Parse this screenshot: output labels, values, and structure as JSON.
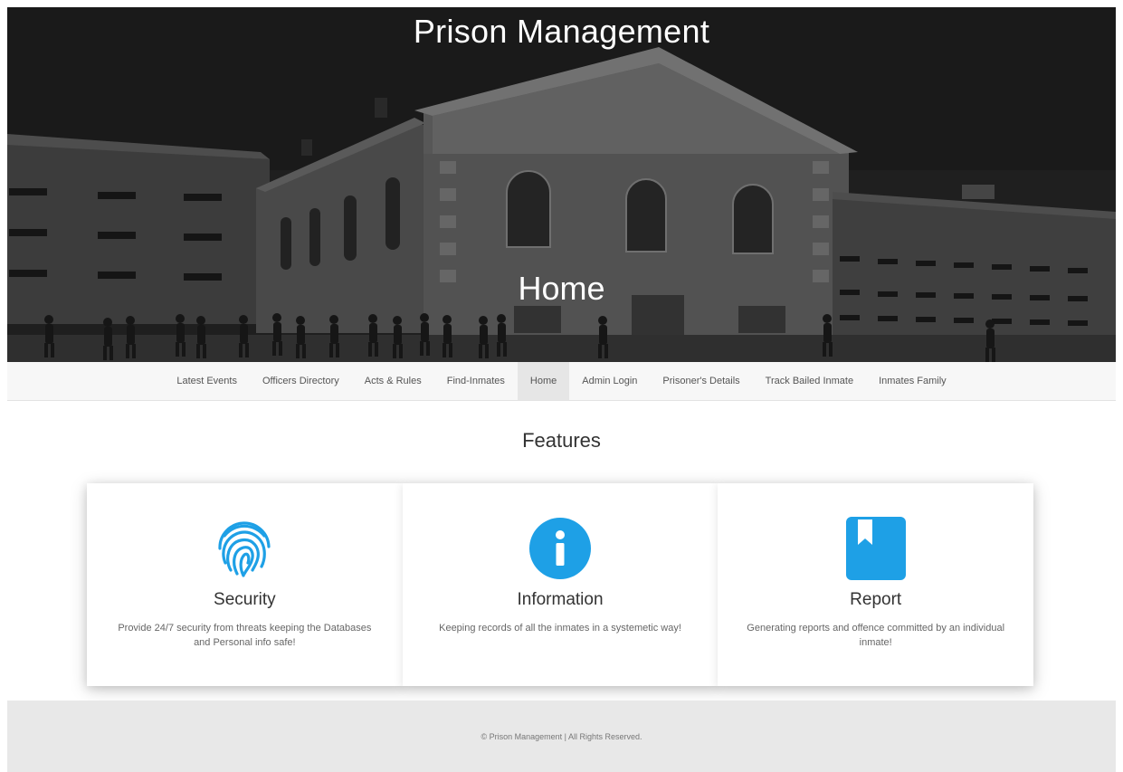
{
  "hero": {
    "title": "Prison Management",
    "subtitle": "Home"
  },
  "nav": {
    "items": [
      {
        "label": "Latest Events"
      },
      {
        "label": "Officers Directory"
      },
      {
        "label": "Acts & Rules"
      },
      {
        "label": "Find-Inmates"
      },
      {
        "label": "Home",
        "active": true
      },
      {
        "label": "Admin Login"
      },
      {
        "label": "Prisoner's Details"
      },
      {
        "label": "Track Bailed Inmate"
      },
      {
        "label": "Inmates Family"
      }
    ]
  },
  "features": {
    "title": "Features",
    "cards": [
      {
        "title": "Security",
        "desc": "Provide 24/7 security from threats keeping the Databases and Personal info safe!",
        "icon": "fingerprint-icon"
      },
      {
        "title": "Information",
        "desc": "Keeping records of all the inmates in a systemetic way!",
        "icon": "info-icon"
      },
      {
        "title": "Report",
        "desc": "Generating reports and offence committed by an individual inmate!",
        "icon": "bookmark-icon"
      }
    ],
    "accent_color": "#1ea0e6"
  },
  "footer": {
    "text": "© Prison Management | All Rights Reserved."
  }
}
